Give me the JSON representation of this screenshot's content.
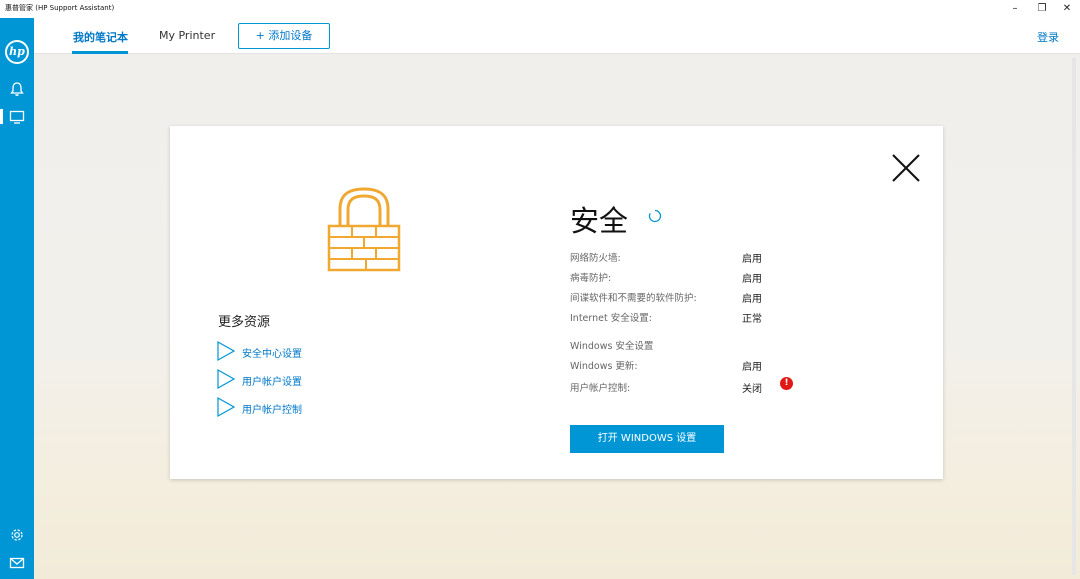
{
  "window": {
    "title": "惠普管家 (HP Support Assistant)",
    "minimize_glyph": "–",
    "restore_glyph": "❐",
    "close_glyph": "✕"
  },
  "sidebar": {
    "logo_text": "hp",
    "accent_color": "#0096d6",
    "icons": [
      "bell-icon",
      "monitor-icon",
      "gear-icon",
      "mail-icon"
    ]
  },
  "topnav": {
    "tabs": [
      {
        "label": "我的笔记本",
        "active": true
      },
      {
        "label": "My Printer",
        "active": false
      }
    ],
    "add_device_label": "+ 添加设备",
    "login_label": "登录"
  },
  "dialog": {
    "resources": {
      "heading": "更多资源",
      "links": [
        "安全中心设置",
        "用户帐户设置",
        "用户帐户控制"
      ]
    },
    "title": "安全",
    "rows": [
      {
        "label": "网络防火墙:",
        "value": "启用"
      },
      {
        "label": "病毒防护:",
        "value": "启用"
      },
      {
        "label": "间谍软件和不需要的软件防护:",
        "value": "启用"
      },
      {
        "label": "Internet 安全设置:",
        "value": "正常"
      }
    ],
    "windows_section": {
      "heading": "Windows 安全设置",
      "rows": [
        {
          "label": "Windows 更新:",
          "value": "启用"
        },
        {
          "label": "用户帐户控制:",
          "value": "关闭",
          "warning": "!"
        }
      ]
    },
    "button_label": "打开 WINDOWS 设置",
    "lock_color": "#f0a830",
    "warning_color": "#e01818"
  }
}
